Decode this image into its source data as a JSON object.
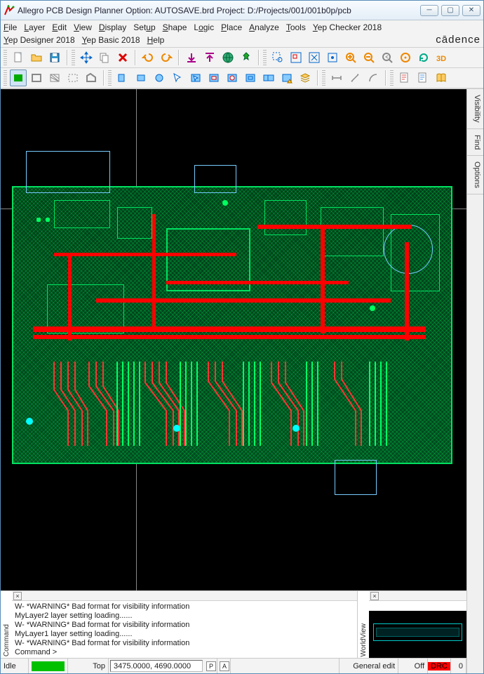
{
  "window": {
    "title": "Allegro PCB Design Planner Option: AUTOSAVE.brd  Project: D:/Projects/001/001b0p/pcb"
  },
  "brand": "cādence",
  "menu": {
    "row1": [
      "File",
      "Layer",
      "Edit",
      "View",
      "Display",
      "Setup",
      "Shape",
      "Logic",
      "Place",
      "Analyze",
      "Tools",
      "Yep Checker 2018"
    ],
    "row2": [
      "Yep Designer 2018",
      "Yep Basic 2018",
      "Help"
    ]
  },
  "sidetabs": [
    "Visibility",
    "Find",
    "Options"
  ],
  "console": {
    "label": "Command",
    "lines": [
      "W- *WARNING* Bad format for visibility information",
      "MyLayer2 layer setting loading......",
      "W- *WARNING* Bad format for visibility information",
      "MyLayer1 layer setting loading......",
      "W- *WARNING* Bad format for visibility information",
      "Command >"
    ]
  },
  "overview_label": "WorldView",
  "status": {
    "idle": "Idle",
    "layer": "Top",
    "coords": "3475.0000, 4690.0000",
    "p": "P",
    "a": "A",
    "mode": "General edit",
    "off": "Off",
    "drc": "DRC",
    "count": "0"
  },
  "icons": {
    "new": "new-file-icon",
    "open": "open-folder-icon",
    "save": "save-icon"
  }
}
